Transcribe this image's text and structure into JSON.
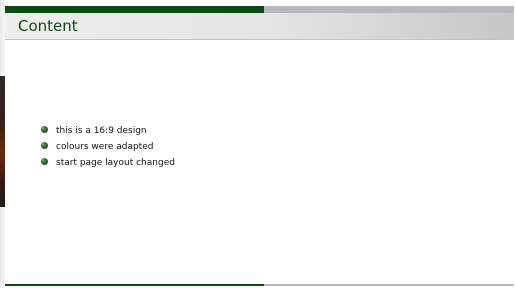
{
  "slide": {
    "title": "Content",
    "bullets": [
      "this is a 16:9 design",
      "colours were adapted",
      "start page layout changed"
    ]
  },
  "colors": {
    "accent_green": "#0b4a12",
    "bar_grey": "#b9b9bd",
    "bullet_green": "#2e6b2e"
  },
  "icons": {
    "bullet": "bullet-dot-icon"
  }
}
